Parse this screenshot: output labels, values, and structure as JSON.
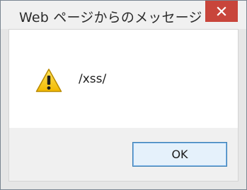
{
  "dialog": {
    "title": "Web ページからのメッセージ",
    "message": "/xss/",
    "ok_label": "OK",
    "icons": {
      "close": "close-icon",
      "warning": "warning-icon"
    },
    "colors": {
      "close_button": "#c8453b",
      "ok_border": "#3c7fb1",
      "ok_background": "#e5f1fb",
      "warning_fill": "#f2c200"
    }
  }
}
